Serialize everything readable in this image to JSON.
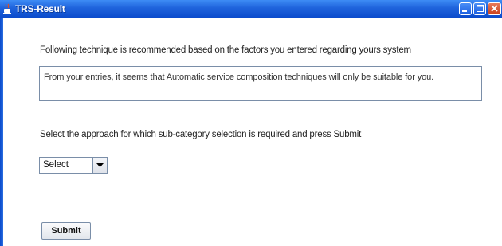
{
  "window": {
    "title": "TRS-Result",
    "controls": {
      "minimize_icon": "minimize-icon",
      "maximize_icon": "maximize-icon",
      "close_icon": "close-icon"
    },
    "colors": {
      "titlebar": "#1f63dc",
      "close_button": "#c8401c"
    }
  },
  "main": {
    "heading": "Following technique is recommended based on the factors you entered regarding yours system",
    "result_text": "From your entries, it seems that Automatic service composition techniques will only be suitable for you.",
    "prompt": "Select the approach for which sub-category selection is required and press Submit",
    "approach_select": {
      "selected": "Select"
    },
    "submit_label": "Submit"
  }
}
